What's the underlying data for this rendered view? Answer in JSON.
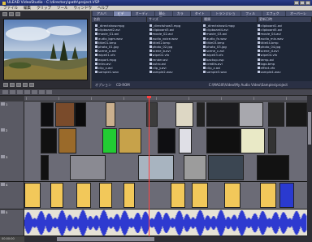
{
  "window": {
    "title": "ULEAD VideoStudio - C:\\directory\\path\\project.VSP"
  },
  "menu": [
    "ファイル",
    "編集",
    "クリップ",
    "ツール",
    "ウィンドウ",
    "ヘルプ"
  ],
  "browser": {
    "tabs": [
      "アルバム",
      "ビデオ",
      "オーディオ",
      "静止画",
      "カラー",
      "タイトル",
      "トランジション",
      "フィルタ",
      "エフェクト",
      "オーバーレイ"
    ],
    "active_tab": 1,
    "columns": [
      "名前",
      "サイズ",
      "種類",
      "更新日時"
    ],
    "files": [
      "_directshow.mpg",
      "_directshow3.mpg",
      "_directshow4.mpg",
      "clipboard1.avi",
      "clipboard2.avi",
      "clipboard3.avi",
      "clipboard4.avi",
      "clipboard5.avi",
      "movie_01.avi",
      "movie_02.avi",
      "movie_03.avi",
      "movie_04.avi",
      "audio_bgm.wav",
      "audio_voice.wav",
      "audio_fx.wav",
      "audio_mix.wav",
      "title01.bmp",
      "title02.bmp",
      "title03.bmp",
      "title04.bmp",
      "photo_01.jpg",
      "photo_02.jpg",
      "photo_03.jpg",
      "photo_04.jpg",
      "scene_a.avi",
      "scene_b.avi",
      "scene_c.avi",
      "scene_d.avi",
      "wipe01.vfx",
      "wipe02.vfx",
      "wipe03.vfx",
      "wipe04.vfx",
      "export.mpg",
      "render.avi",
      "backup.vsp",
      "temp.avi",
      "intro.avi",
      "outro.avi",
      "credits.avi",
      "logo.bmp",
      "clip_x.avi",
      "clip_y.avi",
      "clip_z.avi",
      "effect.vfx",
      "sample1.wav",
      "sample2.wav",
      "sample3.wav",
      "sample4.wav"
    ],
    "status_left": "オプション",
    "status_mid": "CD-ROM",
    "status_path": "C:\\MAGIX\\Video\\My Audio Video\\Samples\\project"
  },
  "timeline": {
    "tracks": [
      {
        "label": "1",
        "kind": "video"
      },
      {
        "label": "2",
        "kind": "video"
      },
      {
        "label": "3",
        "kind": "video"
      },
      {
        "label": "4",
        "kind": "video"
      },
      {
        "label": "5",
        "kind": "title"
      },
      {
        "label": "6",
        "kind": "audio"
      }
    ],
    "status": "00:00:00"
  },
  "colors": {
    "audio_wave": "#2e3ad0",
    "title_clip": "#f2c85a",
    "playhead": "#ff4040",
    "green_clip": "#22cc33"
  },
  "icons": [
    "window-icon",
    "minimize-icon",
    "maximize-icon",
    "close-icon",
    "folder-icon",
    "file-icon",
    "track-icon"
  ]
}
